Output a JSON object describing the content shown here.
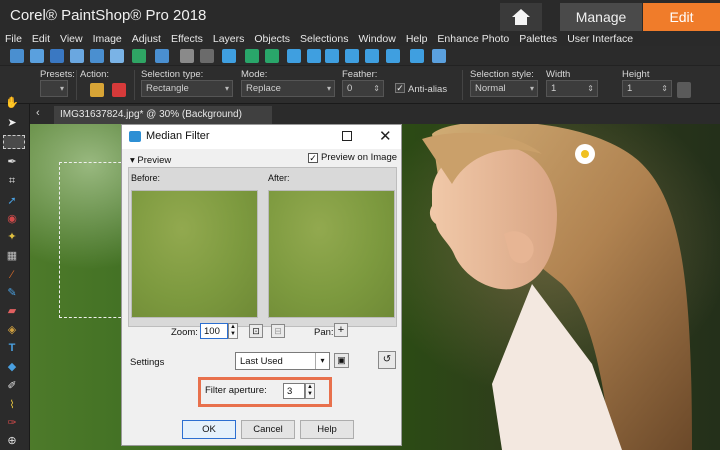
{
  "app": {
    "title": "Corel® PaintShop® Pro 2018",
    "tabs": {
      "manage": "Manage",
      "edit": "Edit"
    }
  },
  "menu": [
    "File",
    "Edit",
    "View",
    "Image",
    "Adjust",
    "Effects",
    "Layers",
    "Objects",
    "Selections",
    "Window",
    "Help",
    "Enhance Photo",
    "Palettes",
    "User Interface"
  ],
  "options": {
    "presets_label": "Presets:",
    "action_label": "Action:",
    "selection_type_label": "Selection type:",
    "selection_type_value": "Rectangle",
    "mode_label": "Mode:",
    "mode_value": "Replace",
    "feather_label": "Feather:",
    "feather_value": "0",
    "antialias_label": "Anti-alias",
    "selection_style_label": "Selection style:",
    "selection_style_value": "Normal",
    "width_label": "Width",
    "width_value": "1",
    "height_label": "Height",
    "height_value": "1"
  },
  "document": {
    "tab_label": "IMG31637824.jpg* @  30% (Background)"
  },
  "dialog": {
    "title": "Median Filter",
    "preview_section": "Preview",
    "preview_on_image": "Preview on Image",
    "before_label": "Before:",
    "after_label": "After:",
    "zoom_label": "Zoom:",
    "zoom_value": "100",
    "pan_label": "Pan:",
    "settings_label": "Settings",
    "settings_value": "Last Used",
    "aperture_label": "Filter aperture:",
    "aperture_value": "3",
    "ok": "OK",
    "cancel": "Cancel",
    "help": "Help"
  },
  "colors": {
    "accent": "#f07c2a",
    "highlight_box": "#e8704c"
  }
}
